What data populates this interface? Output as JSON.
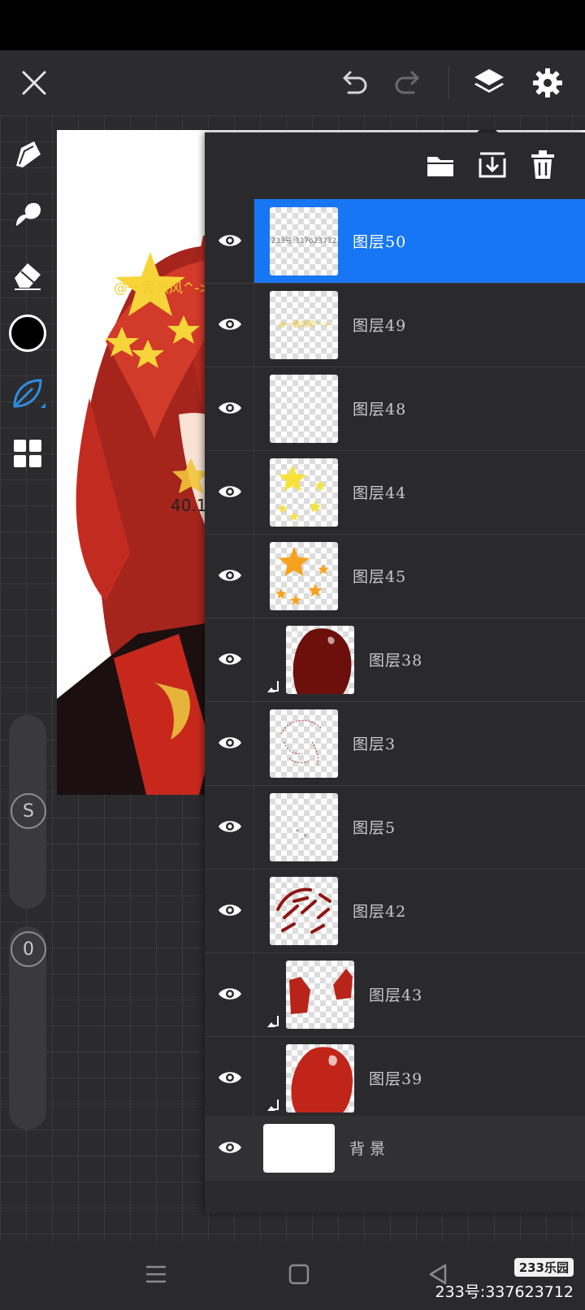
{
  "panel": {
    "layers": [
      {
        "name": "图层50",
        "selected": true,
        "clipped": false,
        "thumb": "id-text",
        "thumb_text": "233号:337623712"
      },
      {
        "name": "图层49",
        "selected": false,
        "clipped": false,
        "thumb": "yellow-text",
        "thumb_text": "@一雲溦风^->"
      },
      {
        "name": "图层48",
        "selected": false,
        "clipped": false,
        "thumb": "empty"
      },
      {
        "name": "图层44",
        "selected": false,
        "clipped": false,
        "thumb": "yellow-stars"
      },
      {
        "name": "图层45",
        "selected": false,
        "clipped": false,
        "thumb": "orange-stars"
      },
      {
        "name": "图层38",
        "selected": false,
        "clipped": true,
        "thumb": "dark-red-blob"
      },
      {
        "name": "图层3",
        "selected": false,
        "clipped": false,
        "thumb": "sketch"
      },
      {
        "name": "图层5",
        "selected": false,
        "clipped": false,
        "thumb": "specks"
      },
      {
        "name": "图层42",
        "selected": false,
        "clipped": false,
        "thumb": "hair-lines"
      },
      {
        "name": "图层43",
        "selected": false,
        "clipped": true,
        "thumb": "red-shapes"
      },
      {
        "name": "图层39",
        "selected": false,
        "clipped": true,
        "thumb": "red-blob"
      }
    ],
    "background_layer": {
      "name": "背景"
    }
  },
  "artwork": {
    "text_overlay": "@一雲溦风^->",
    "partial_number": "40.1"
  },
  "sliders": {
    "size_label": "S",
    "opacity_label": "0"
  },
  "watermark": {
    "logo": "233乐园",
    "text": "233号:337623712"
  },
  "colors": {
    "accent": "#1676f3",
    "current_color": "#000000",
    "active_tool": "#2f8de0"
  },
  "icons": {
    "topbar": [
      "close-icon",
      "undo-icon",
      "redo-icon",
      "layers-icon",
      "settings-icon"
    ],
    "panel_actions": [
      "folder-icon",
      "merge-down-icon",
      "trash-icon"
    ],
    "tools": [
      "pencil-icon",
      "smudge-icon",
      "eraser-icon",
      "color-swatch",
      "brush-leaf-icon",
      "grid-menu-icon"
    ],
    "nav": [
      "menu-icon",
      "home-icon",
      "back-icon"
    ]
  }
}
